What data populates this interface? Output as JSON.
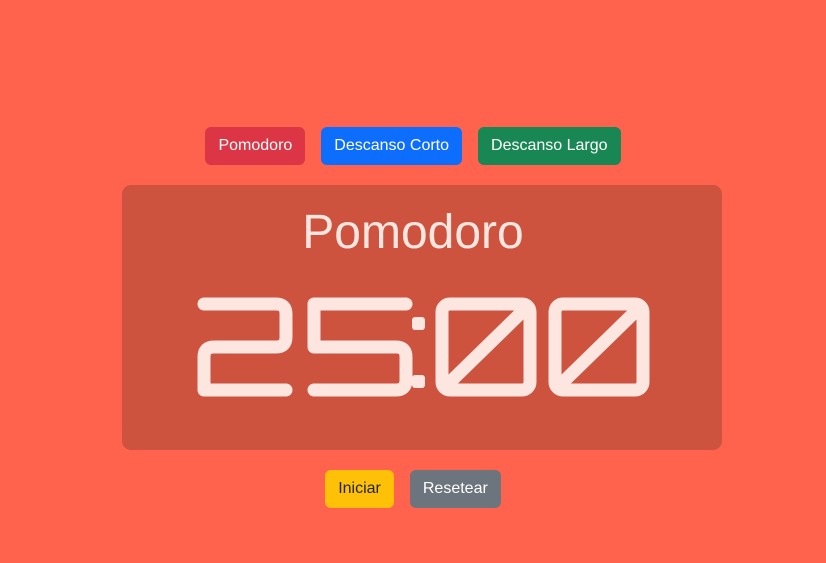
{
  "modes": {
    "pomodoro_label": "Pomodoro",
    "short_break_label": "Descanso Corto",
    "long_break_label": "Descanso Largo"
  },
  "timer": {
    "mode_title": "Pomodoro",
    "time": "25:00"
  },
  "controls": {
    "start_label": "Iniciar",
    "reset_label": "Resetear"
  },
  "colors": {
    "background": "#ff634d",
    "card": "#cd533f",
    "digits": "#fde5e0",
    "pomodoro_button": "#dc3545",
    "short_break_button": "#0d6efd",
    "long_break_button": "#198754",
    "start_button": "#ffc107",
    "reset_button": "#6c757d"
  }
}
